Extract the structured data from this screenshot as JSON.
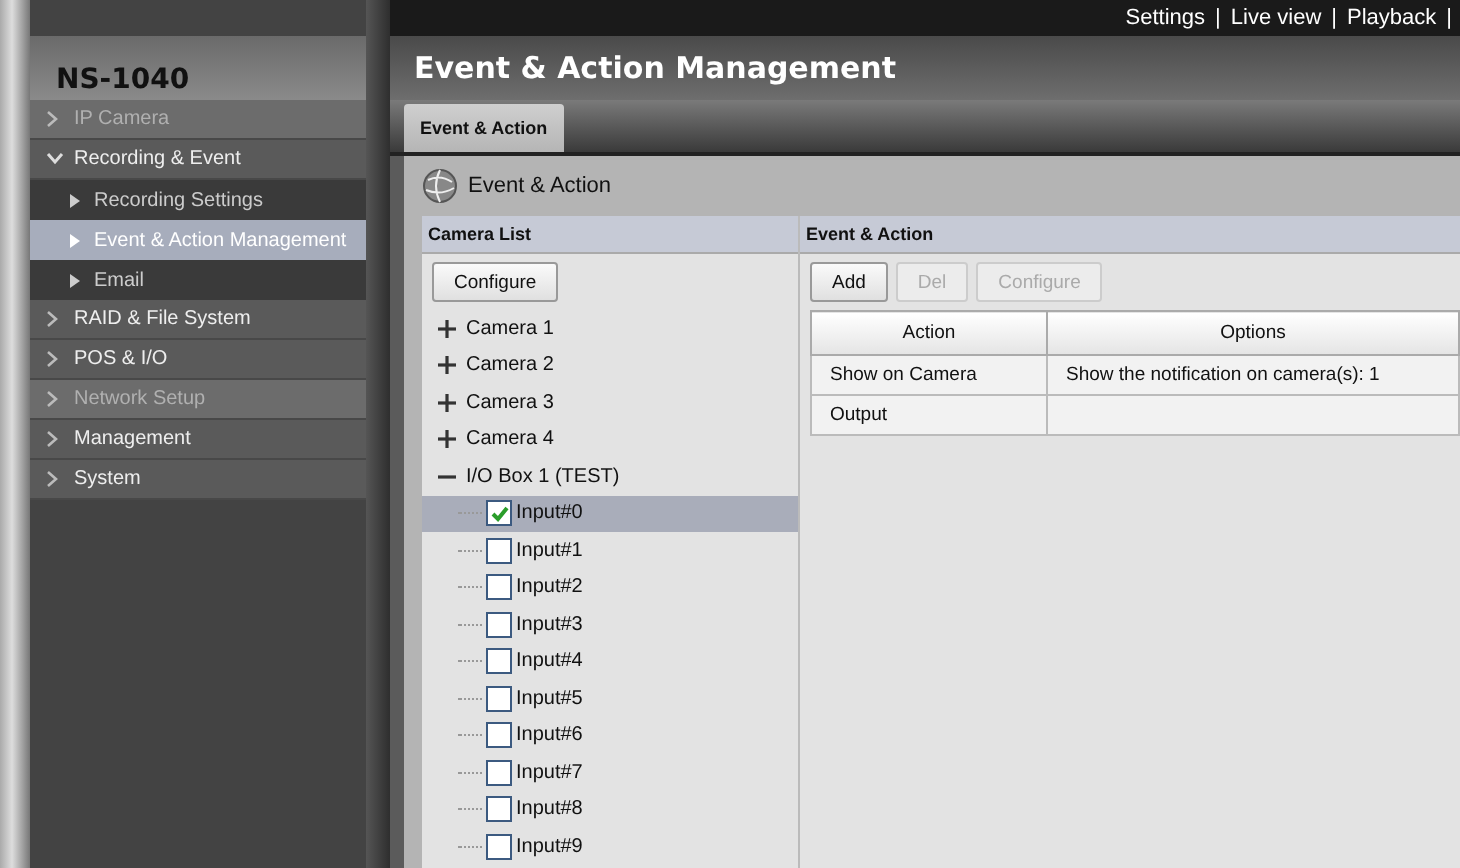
{
  "top_links": [
    "Settings",
    "|",
    "Live view",
    "|",
    "Playback",
    "|"
  ],
  "sidebar": {
    "title": "NS-1040",
    "items": [
      {
        "label": "IP Camera",
        "disabled": true,
        "expanded": false
      },
      {
        "label": "Recording & Event",
        "disabled": false,
        "expanded": true,
        "children": [
          {
            "label": "Recording Settings",
            "selected": false
          },
          {
            "label": "Event & Action Management",
            "selected": true
          },
          {
            "label": "Email",
            "selected": false
          }
        ]
      },
      {
        "label": "RAID & File System",
        "disabled": false,
        "expanded": false
      },
      {
        "label": "POS & I/O",
        "disabled": false,
        "expanded": false
      },
      {
        "label": "Network Setup",
        "disabled": true,
        "expanded": false
      },
      {
        "label": "Management",
        "disabled": false,
        "expanded": false
      },
      {
        "label": "System",
        "disabled": false,
        "expanded": false
      }
    ]
  },
  "page_title": "Event & Action Management",
  "tabs": [
    {
      "label": "Event & Action",
      "selected": true
    }
  ],
  "section_title": "Event & Action",
  "camera_list": {
    "heading": "Camera List",
    "button": "Configure",
    "tree": [
      {
        "label": "Camera 1",
        "expanded": false
      },
      {
        "label": "Camera 2",
        "expanded": false
      },
      {
        "label": "Camera 3",
        "expanded": false
      },
      {
        "label": "Camera 4",
        "expanded": false
      },
      {
        "label": "I/O Box 1 (TEST)",
        "expanded": true,
        "children": [
          {
            "label": "Input#0",
            "checked": true,
            "selected": true
          },
          {
            "label": "Input#1",
            "checked": false,
            "selected": false
          },
          {
            "label": "Input#2",
            "checked": false,
            "selected": false
          },
          {
            "label": "Input#3",
            "checked": false,
            "selected": false
          },
          {
            "label": "Input#4",
            "checked": false,
            "selected": false
          },
          {
            "label": "Input#5",
            "checked": false,
            "selected": false
          },
          {
            "label": "Input#6",
            "checked": false,
            "selected": false
          },
          {
            "label": "Input#7",
            "checked": false,
            "selected": false
          },
          {
            "label": "Input#8",
            "checked": false,
            "selected": false
          },
          {
            "label": "Input#9",
            "checked": false,
            "selected": false
          }
        ]
      }
    ]
  },
  "event_action": {
    "heading": "Event & Action",
    "buttons": [
      {
        "label": "Add",
        "disabled": false
      },
      {
        "label": "Del",
        "disabled": true
      },
      {
        "label": "Configure",
        "disabled": true
      }
    ],
    "table": {
      "columns": [
        "Action",
        "Options"
      ],
      "rows": [
        [
          "Show on Camera",
          "Show the notification on camera(s): 1"
        ],
        [
          "Output",
          ""
        ]
      ]
    }
  }
}
